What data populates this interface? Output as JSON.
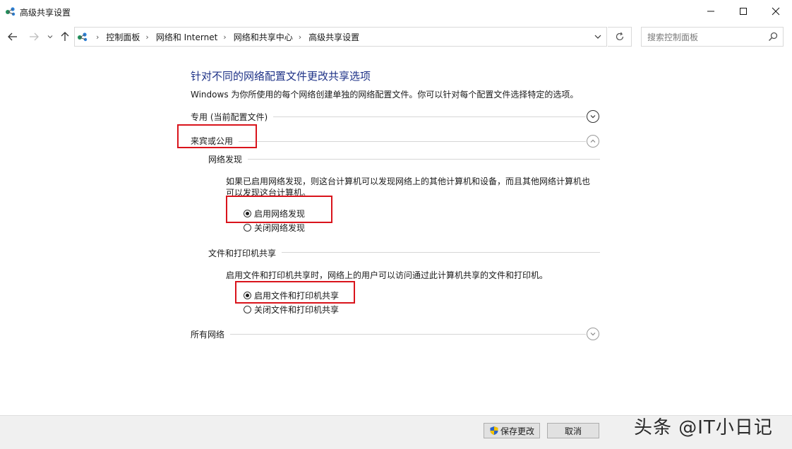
{
  "window": {
    "title": "高级共享设置"
  },
  "address": {
    "breadcrumbs": [
      "控制面板",
      "网络和 Internet",
      "网络和共享中心",
      "高级共享设置"
    ]
  },
  "search": {
    "placeholder": "搜索控制面板"
  },
  "content": {
    "heading": "针对不同的网络配置文件更改共享选项",
    "description": "Windows 为你所使用的每个网络创建单独的网络配置文件。你可以针对每个配置文件选择特定的选项。",
    "profiles": {
      "private": {
        "label": "专用 (当前配置文件)"
      },
      "guest_public": {
        "label": "来宾或公用",
        "network_discovery": {
          "label": "网络发现",
          "text_line1": "如果已启用网络发现，则这台计算机可以发现网络上的其他计算机和设备，而且其他网络计算机也",
          "text_line2": "可以发现这台计算机。",
          "options": [
            "启用网络发现",
            "关闭网络发现"
          ],
          "selected": "启用网络发现"
        },
        "file_printer_sharing": {
          "label": "文件和打印机共享",
          "text": "启用文件和打印机共享时，网络上的用户可以访问通过此计算机共享的文件和打印机。",
          "options": [
            "启用文件和打印机共享",
            "关闭文件和打印机共享"
          ],
          "selected": "启用文件和打印机共享"
        }
      },
      "all_networks": {
        "label": "所有网络"
      }
    }
  },
  "footer": {
    "save_label": "保存更改",
    "cancel_label": "取消"
  },
  "watermark": {
    "text": "头条 @IT小日记"
  },
  "colors": {
    "heading": "#1e3287",
    "highlight_box": "#d9141c",
    "footer_bg": "#f0f0f0"
  },
  "icons": {
    "app": "network-icon",
    "back": "arrow-left-icon",
    "forward": "arrow-right-icon",
    "recent": "chevron-down-icon",
    "up": "arrow-up-icon",
    "refresh": "refresh-icon",
    "search": "search-icon",
    "expand": "chevron-down-circle-icon",
    "collapse": "chevron-up-circle-icon",
    "shield": "uac-shield-icon"
  }
}
